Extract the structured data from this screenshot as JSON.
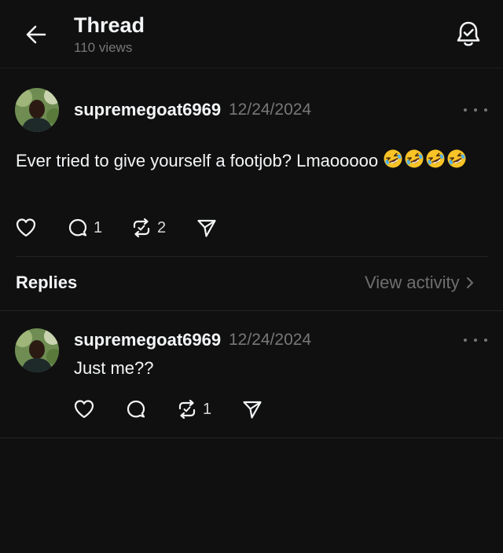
{
  "header": {
    "title": "Thread",
    "views": "110 views"
  },
  "post": {
    "username": "supremegoat6969",
    "date": "12/24/2024",
    "text": "Ever tried to give yourself a footjob? Lmaooooo",
    "emoji_count": 4,
    "replies_count": "1",
    "reposts_count": "2"
  },
  "replies_section": {
    "label": "Replies",
    "view_activity": "View activity"
  },
  "reply": {
    "username": "supremegoat6969",
    "date": "12/24/2024",
    "text": "Just me??",
    "reposts_count": "1"
  },
  "colors": {
    "background": "#101010",
    "text_primary": "#f3f5f7",
    "text_secondary": "#777777",
    "divider": "#232323"
  }
}
